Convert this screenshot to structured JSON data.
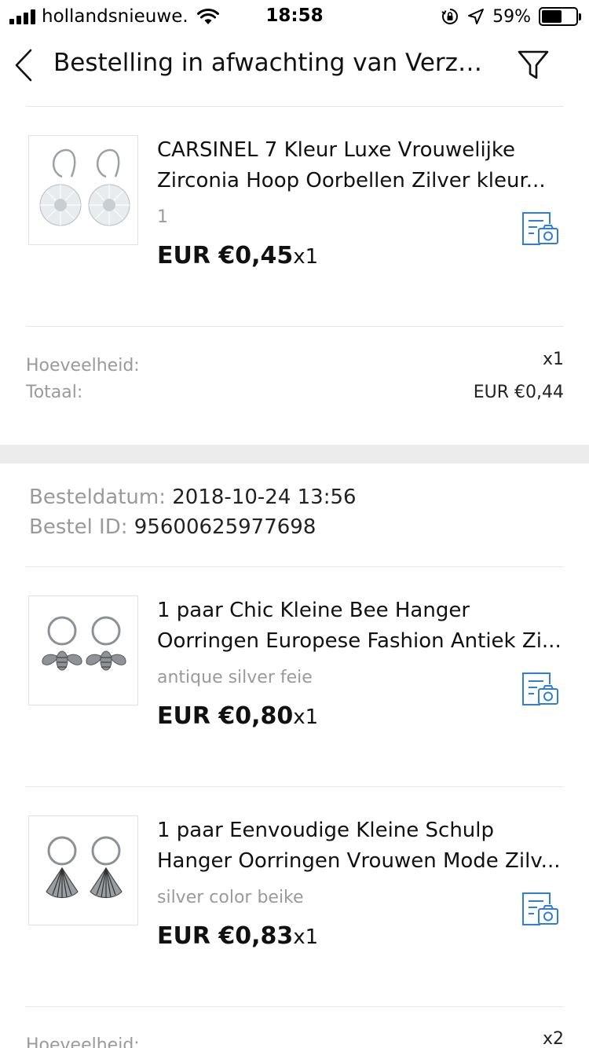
{
  "status_bar": {
    "carrier": "hollandsnieuwe.",
    "time": "18:58",
    "battery": "59%",
    "battery_level": 0.59
  },
  "nav": {
    "title": "Bestelling in afwachting van Verzen...",
    "back_icon": "chevron-left-icon",
    "filter_icon": "filter-icon"
  },
  "order1": {
    "items": [
      {
        "title_line1": "CARSINEL 7 Kleur Luxe Vrouwelijke",
        "title_line2": "Zirconia Hoop Oorbellen Zilver kleur...",
        "variant": "1",
        "price": "EUR €0,45",
        "qty": "x1"
      }
    ],
    "summary": {
      "quantity_label": "Hoeveelheid:",
      "quantity_value": "x1",
      "total_label": "Totaal:",
      "total_value": "EUR €0,44"
    }
  },
  "order2": {
    "date_label": "Besteldatum:",
    "date_value": "2018-10-24 13:56",
    "id_label": "Bestel ID:",
    "id_value": "95600625977698",
    "items": [
      {
        "title_line1": "1 paar Chic Kleine Bee Hanger",
        "title_line2": "Oorringen Europese Fashion Antiek Zi...",
        "variant": "antique silver feie",
        "price": "EUR €0,80",
        "qty": "x1"
      },
      {
        "title_line1": "1 paar Eenvoudige Kleine Schulp",
        "title_line2": "Hanger Oorringen Vrouwen Mode Zilv...",
        "variant": "silver color beike",
        "price": "EUR €0,83",
        "qty": "x1"
      }
    ],
    "summary": {
      "quantity_label": "Hoeveelheid:",
      "quantity_value": "x2"
    }
  },
  "colors": {
    "accent_blue": "#2f7fd6",
    "muted_text": "#9a9a9a",
    "divider": "#e6e6e6",
    "section_gap": "#ececec"
  }
}
